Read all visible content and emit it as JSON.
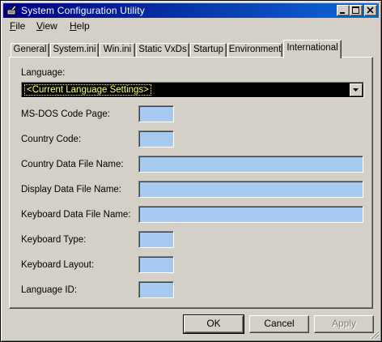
{
  "window": {
    "title": "System Configuration Utility",
    "icon": "msconfig-app-icon",
    "controls": [
      "minimize-icon",
      "maximize-icon",
      "close-icon"
    ]
  },
  "menu": [
    {
      "label": "File",
      "mnemonic": "F"
    },
    {
      "label": "View",
      "mnemonic": "V"
    },
    {
      "label": "Help",
      "mnemonic": "H"
    }
  ],
  "tabs": [
    {
      "label": "General",
      "active": false
    },
    {
      "label": "System.ini",
      "active": false
    },
    {
      "label": "Win.ini",
      "active": false
    },
    {
      "label": "Static VxDs",
      "active": false
    },
    {
      "label": "Startup",
      "active": false
    },
    {
      "label": "Environment",
      "active": false
    },
    {
      "label": "International",
      "active": true
    }
  ],
  "international": {
    "language_label": "Language:",
    "language_value": "<Current Language Settings>",
    "fields": [
      {
        "label": "MS-DOS Code Page:",
        "value": ""
      },
      {
        "label": "Country Code:",
        "value": ""
      },
      {
        "label": "Country Data File Name:",
        "value": ""
      },
      {
        "label": "Display Data File Name:",
        "value": ""
      },
      {
        "label": "Keyboard Data File Name:",
        "value": ""
      },
      {
        "label": "Keyboard Type:",
        "value": ""
      },
      {
        "label": "Keyboard Layout:",
        "value": ""
      },
      {
        "label": "Language ID:",
        "value": ""
      }
    ]
  },
  "buttons": {
    "ok": "OK",
    "cancel": "Cancel",
    "apply": "Apply"
  },
  "colors": {
    "titlebar_start": "#000080",
    "titlebar_end": "#0f6ad6",
    "field_fill": "#a6caf0",
    "dropdown_bg": "#000000",
    "dropdown_text": "#ffff66",
    "face": "#d4d0c8"
  }
}
